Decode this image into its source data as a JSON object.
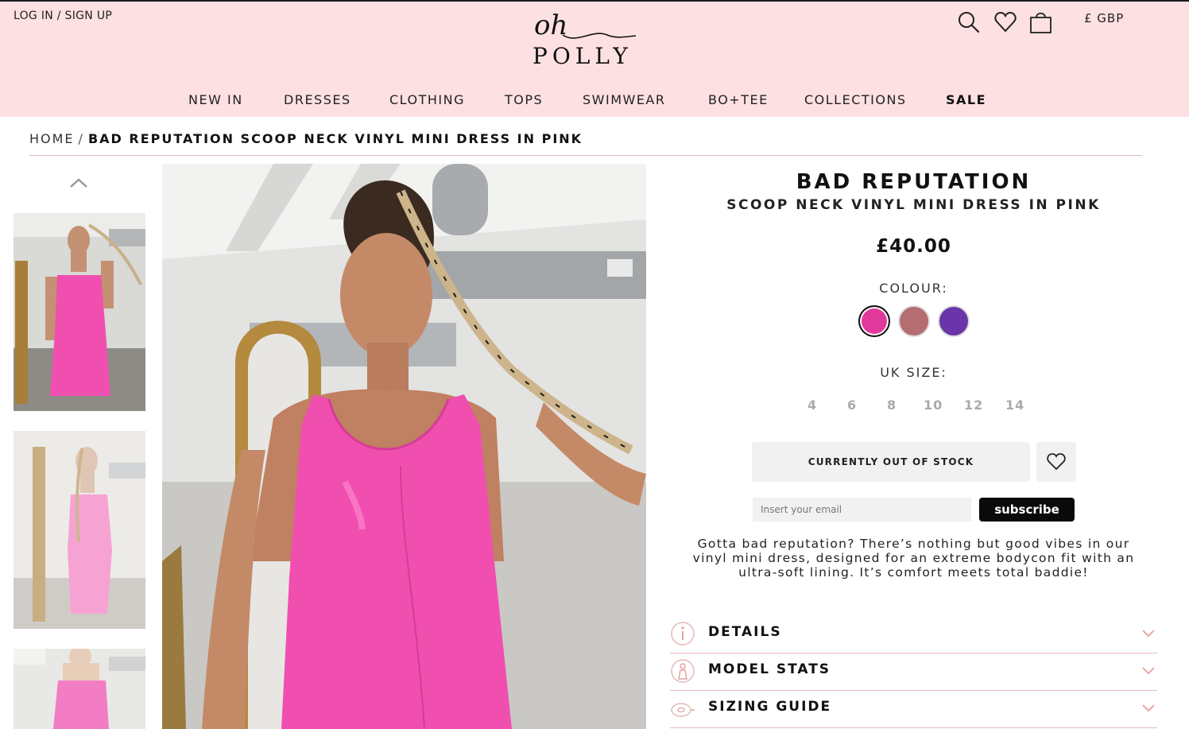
{
  "header": {
    "login_label": "LOG IN / SIGN UP",
    "logo_script": "oh",
    "logo_word": "POLLY",
    "currency_label": "£ GBP",
    "icons": [
      "search-icon",
      "heart-icon",
      "shopping-bag-icon"
    ]
  },
  "nav": {
    "items": [
      "NEW IN",
      "DRESSES",
      "CLOTHING",
      "TOPS",
      "SWIMWEAR",
      "BO+TEE",
      "COLLECTIONS",
      "SALE"
    ]
  },
  "breadcrumb": {
    "home": "HOME",
    "separator": "/",
    "current": "BAD REPUTATION SCOOP NECK VINYL MINI DRESS IN PINK"
  },
  "product": {
    "title": "BAD REPUTATION",
    "subtitle": "SCOOP NECK VINYL MINI DRESS IN PINK",
    "price": "£40.00",
    "colour_label": "COLOUR:",
    "colours": [
      {
        "name": "pink",
        "hex": "#e0389b",
        "selected": true
      },
      {
        "name": "dusty-rose",
        "hex": "#b56d72",
        "selected": false
      },
      {
        "name": "purple",
        "hex": "#6a35a8",
        "selected": false
      }
    ],
    "size_label": "UK SIZE:",
    "sizes": [
      "4",
      "6",
      "8",
      "10",
      "12",
      "14"
    ],
    "stock_button": "CURRENTLY OUT OF STOCK",
    "email_placeholder": "Insert your email",
    "subscribe_label": "subscribe",
    "description": "Gotta bad reputation? There’s nothing but good vibes in our vinyl mini dress, designed for an extreme bodycon fit with an ultra-soft lining. It’s comfort meets total baddie!",
    "accordion": [
      {
        "label": "DETAILS",
        "icon": "info-icon"
      },
      {
        "label": "MODEL STATS",
        "icon": "model-icon"
      },
      {
        "label": "SIZING GUIDE",
        "icon": "tape-measure-icon"
      }
    ]
  },
  "colors": {
    "header_bg": "#fde0e2",
    "accent_rule": "#e6b8b8",
    "dress_pink": "#f04fb0",
    "button_grey": "#f1f1f1"
  }
}
